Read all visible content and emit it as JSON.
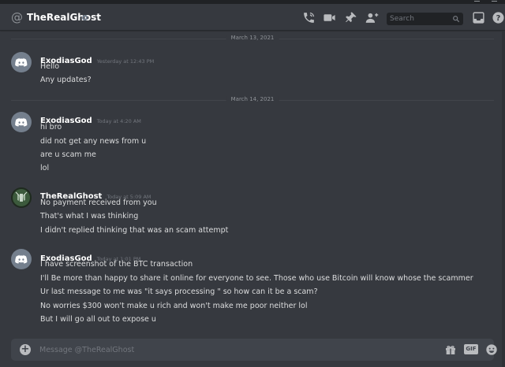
{
  "channel": {
    "name": "TheRealGhost",
    "at_icon": "at-icon",
    "status_icon": "status-offline-icon"
  },
  "header_icons": [
    "phone-call-icon",
    "video-camera-icon",
    "pin-icon",
    "add-member-icon",
    "inbox-icon",
    "help-icon"
  ],
  "search": {
    "placeholder": "Search",
    "icon": "magnifier-icon"
  },
  "dividers": [
    {
      "label": "March 13, 2021"
    },
    {
      "label": "March 14, 2021"
    }
  ],
  "messages": [
    {
      "author": "ExodiasGod",
      "timestamp": "Yesterday at 12:43 PM",
      "avatar": "discord-logo-avatar",
      "lines": [
        "Hello",
        "Any updates?"
      ]
    },
    {
      "author": "ExodiasGod",
      "timestamp": "Today at 4:20 AM",
      "avatar": "discord-logo-avatar",
      "lines": [
        "hi bro",
        "did not get any news from u",
        "are u scam me",
        "lol"
      ]
    },
    {
      "author": "TheRealGhost",
      "timestamp": "Today at 5:09 AM",
      "avatar": "ghost-avatar",
      "lines": [
        "No payment received from you",
        "That's what I was thinking",
        "I didn't replied thinking that was an scam attempt"
      ]
    },
    {
      "author": "ExodiasGod",
      "timestamp": "Today at 1:01 PM",
      "avatar": "discord-logo-avatar",
      "lines": [
        "I have screenshot of the BTC transaction",
        "I'll Be more than happy to share it online for everyone to see. Those who use Bitcoin will know whose the scammer",
        "Ur last message to me was \"it says processing \" so how can it be a scam?",
        "No worries $300 won't make u rich and won't make me poor neither lol",
        "But I will go all out to expose u"
      ]
    }
  ],
  "composer": {
    "placeholder": "Message @TheRealGhost",
    "gif_label": "GIF",
    "icons": [
      "plus-icon",
      "gift-icon",
      "emoji-icon"
    ]
  },
  "colors": {
    "background": "#36393f",
    "text": "#dcddde",
    "muted": "#72767d",
    "input": "#40444b"
  }
}
